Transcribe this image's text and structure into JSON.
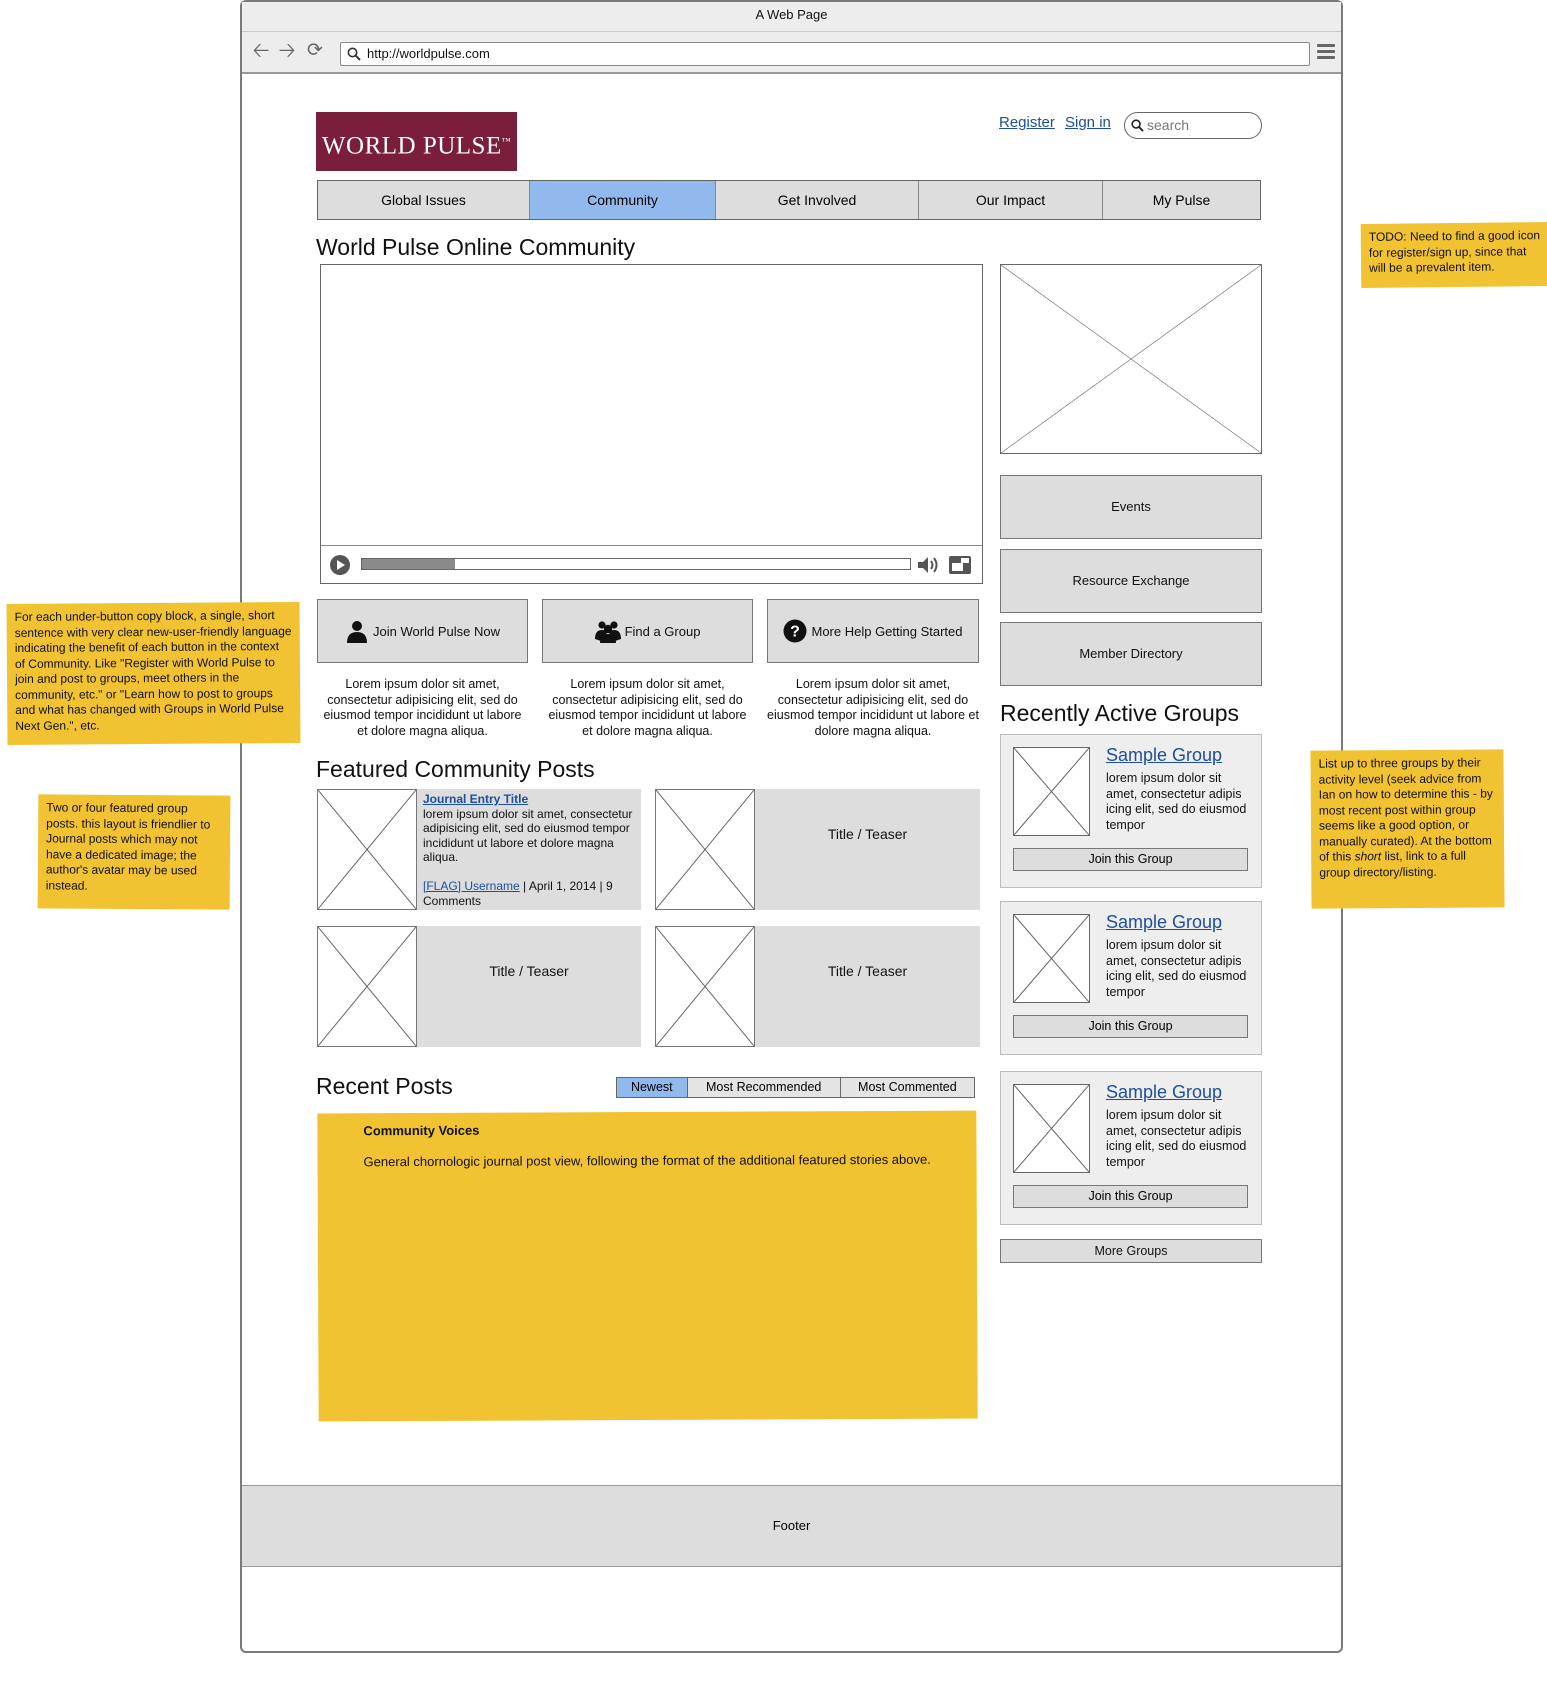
{
  "window": {
    "title": "A Web Page",
    "url": "http://worldpulse.com"
  },
  "header": {
    "logo_text": "WORLD PULSE",
    "logo_mark": "™",
    "register": "Register",
    "sign_in": "Sign in",
    "search_placeholder": "search"
  },
  "nav": [
    "Global Issues",
    "Community",
    "Get Involved",
    "Our Impact",
    "My Pulse"
  ],
  "nav_active": "Community",
  "colors": {
    "brand": "#7a1e3c",
    "active_tab": "#92b9ee",
    "note": "#f1c232",
    "link": "#1d4f9e"
  },
  "main": {
    "title": "World Pulse Online Community",
    "video": {
      "progress_percent": 17
    },
    "cta_buttons": [
      {
        "label": "Join World Pulse Now",
        "icon": "user-icon"
      },
      {
        "label": "Find a Group",
        "icon": "group-icon"
      },
      {
        "label": "More Help Getting Started",
        "icon": "question-icon"
      }
    ],
    "blurbs": [
      "Lorem ipsum dolor sit amet, consectetur adipisicing elit, sed do eiusmod tempor incididunt ut labore et dolore magna aliqua.",
      "Lorem ipsum dolor sit amet, consectetur adipisicing elit, sed do eiusmod tempor incididunt ut labore et dolore magna aliqua.",
      "Lorem ipsum dolor sit amet, consectetur adipisicing elit, sed do eiusmod tempor incididunt ut labore et dolore magna aliqua."
    ]
  },
  "featured": {
    "title": "Featured Community Posts",
    "first": {
      "entry_title": "Journal Entry Title",
      "body": "lorem ipsum dolor sit amet, consectetur adipisicing elit, sed do eiusmod tempor incididunt ut labore et dolore magna aliqua.",
      "author_link": "[FLAG] Username",
      "meta": " | April 1, 2014 | 9 Comments"
    },
    "teaser": "Title / Teaser"
  },
  "recent": {
    "title": "Recent Posts",
    "tabs": [
      "Newest",
      "Most Recommended",
      "Most Commented"
    ],
    "active_tab": "Newest",
    "note_title": "Community Voices",
    "note_body": "General chornologic journal post view, following the format of the additional featured stories above."
  },
  "sidebar": {
    "buttons": [
      "Events",
      "Resource Exchange",
      "Member Directory"
    ],
    "groups_title": "Recently Active Groups",
    "groups": [
      {
        "name": "Sample Group",
        "desc": "lorem ipsum dolor sit amet, consectetur adipis icing elit, sed do eiusmod tempor",
        "button": "Join this Group"
      },
      {
        "name": "Sample Group",
        "desc": "lorem ipsum dolor sit amet, consectetur adipis icing elit, sed do eiusmod tempor",
        "button": "Join this Group"
      },
      {
        "name": "Sample Group",
        "desc": "lorem ipsum dolor sit amet, consectetur adipis icing elit, sed do eiusmod tempor",
        "button": "Join this Group"
      }
    ],
    "more_groups": "More Groups"
  },
  "footer": "Footer",
  "notes": {
    "todo": "TODO: Need to find a good icon for register/sign up, since that will be a prevalent item.",
    "under_button": "For each under-button copy block, a single, short sentence with very clear new-user-friendly language indicating the benefit of each button in the context of Community. Like \"Register with World Pulse to join and post to groups, meet others in the community, etc.\" or \"Learn how to post to groups and what has changed with Groups in World Pulse Next Gen.\", etc.",
    "featured": "Two or four featured group posts. this layout is friendlier to Journal posts which may not have a dedicated image; the author's avatar may be used instead.",
    "groups_before": "List up to three groups by their activity level (seek advice from Ian on how to determine this - by most recent post within group seems like a good option, or manually curated). At the bottom of this ",
    "groups_em": "short",
    "groups_after": " list, link to a full group directory/listing."
  }
}
